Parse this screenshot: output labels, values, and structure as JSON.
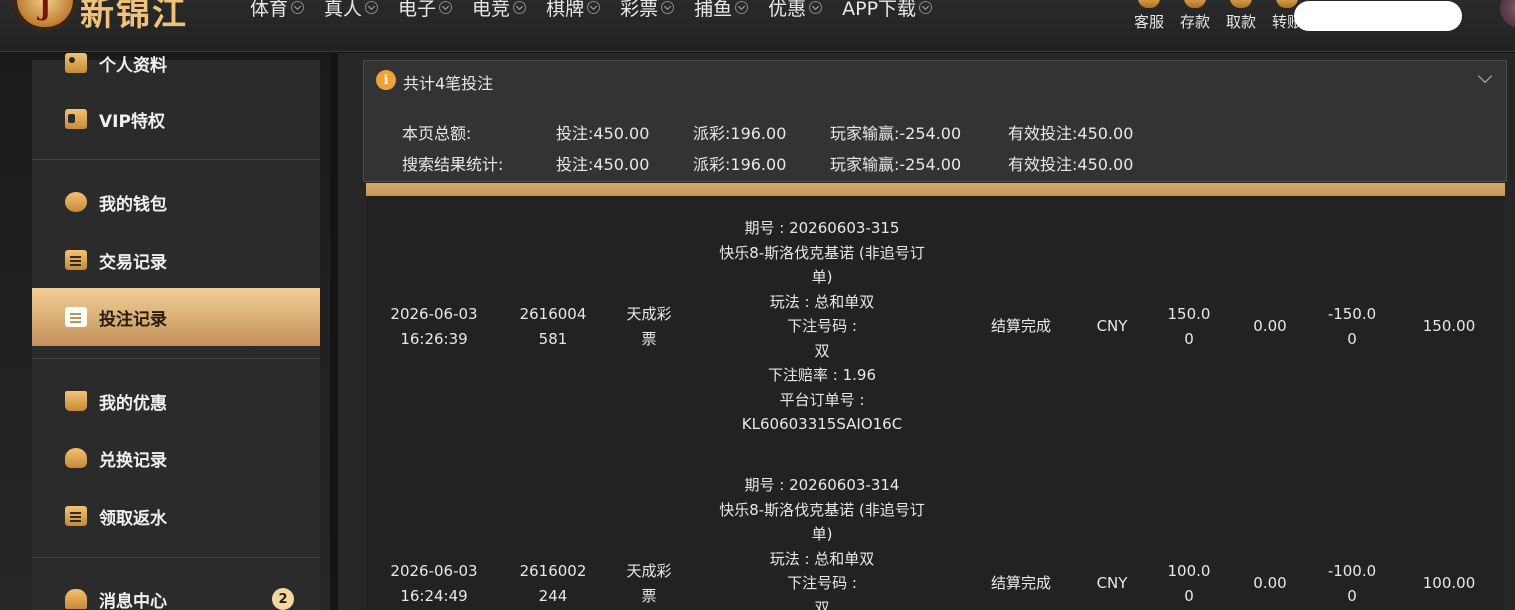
{
  "brand": {
    "logo_letter": "J",
    "name": "新锦江"
  },
  "nav": [
    {
      "label": "体育"
    },
    {
      "label": "真人"
    },
    {
      "label": "电子"
    },
    {
      "label": "电竞"
    },
    {
      "label": "棋牌"
    },
    {
      "label": "彩票"
    },
    {
      "label": "捕鱼"
    },
    {
      "label": "优惠"
    },
    {
      "label": "APP下载"
    }
  ],
  "quick_actions": [
    {
      "label": "客服",
      "icon": "headset-icon"
    },
    {
      "label": "存款",
      "icon": "deposit-icon"
    },
    {
      "label": "取款",
      "icon": "withdraw-icon"
    },
    {
      "label": "转账",
      "icon": "transfer-icon"
    }
  ],
  "sidebar": {
    "items": [
      {
        "label": "个人资料",
        "icon": "user-card-icon"
      },
      {
        "label": "VIP特权",
        "icon": "vip-card-icon"
      },
      {
        "label": "我的钱包",
        "icon": "piggy-bank-icon"
      },
      {
        "label": "交易记录",
        "icon": "document-icon"
      },
      {
        "label": "投注记录",
        "icon": "document-icon",
        "active": true
      },
      {
        "label": "我的优惠",
        "icon": "gift-bag-icon"
      },
      {
        "label": "兑换记录",
        "icon": "exchange-icon"
      },
      {
        "label": "领取返水",
        "icon": "clipboard-icon"
      },
      {
        "label": "消息中心",
        "icon": "bell-icon",
        "badge": "2"
      }
    ]
  },
  "summary": {
    "title": "共计4笔投注",
    "rows": [
      {
        "label": "本页总额:",
        "bet": "投注:450.00",
        "payout": "派彩:196.00",
        "player_win": "玩家输赢:-254.00",
        "valid_bet": "有效投注:450.00"
      },
      {
        "label": "搜索结果统计:",
        "bet": "投注:450.00",
        "payout": "派彩:196.00",
        "player_win": "玩家输赢:-254.00",
        "valid_bet": "有效投注:450.00"
      }
    ]
  },
  "colors": {
    "accent": "#d9a865",
    "info": "#f0a23a",
    "active_item": "#f2cf97"
  },
  "bets": [
    {
      "time": [
        "2026-06-03",
        "16:26:39"
      ],
      "order_id": [
        "2616004",
        "581"
      ],
      "platform": [
        "天成彩",
        "票"
      ],
      "details": [
        "期号 : 20260603-315",
        "快乐8-斯洛伐克基诺 (非追号订",
        "单)",
        "玩法 : 总和单双",
        "下注号码 :",
        "双",
        "下注赔率 : 1.96",
        "平台订单号 :",
        "KL60603315SAIO16C"
      ],
      "status": "结算完成",
      "currency": "CNY",
      "bet_amount": [
        "150.0",
        "0"
      ],
      "payout": "0.00",
      "win_loss": [
        "-150.0",
        "0"
      ],
      "valid_bet": "150.00"
    },
    {
      "time": [
        "2026-06-03",
        "16:24:49"
      ],
      "order_id": [
        "2616002",
        "244"
      ],
      "platform": [
        "天成彩",
        "票"
      ],
      "details": [
        "期号 : 20260603-314",
        "快乐8-斯洛伐克基诺 (非追号订",
        "单)",
        "玩法 : 总和单双",
        "下注号码 :",
        "双"
      ],
      "status": "结算完成",
      "currency": "CNY",
      "bet_amount": [
        "100.0",
        "0"
      ],
      "payout": "0.00",
      "win_loss": [
        "-100.0",
        "0"
      ],
      "valid_bet": "100.00"
    }
  ]
}
